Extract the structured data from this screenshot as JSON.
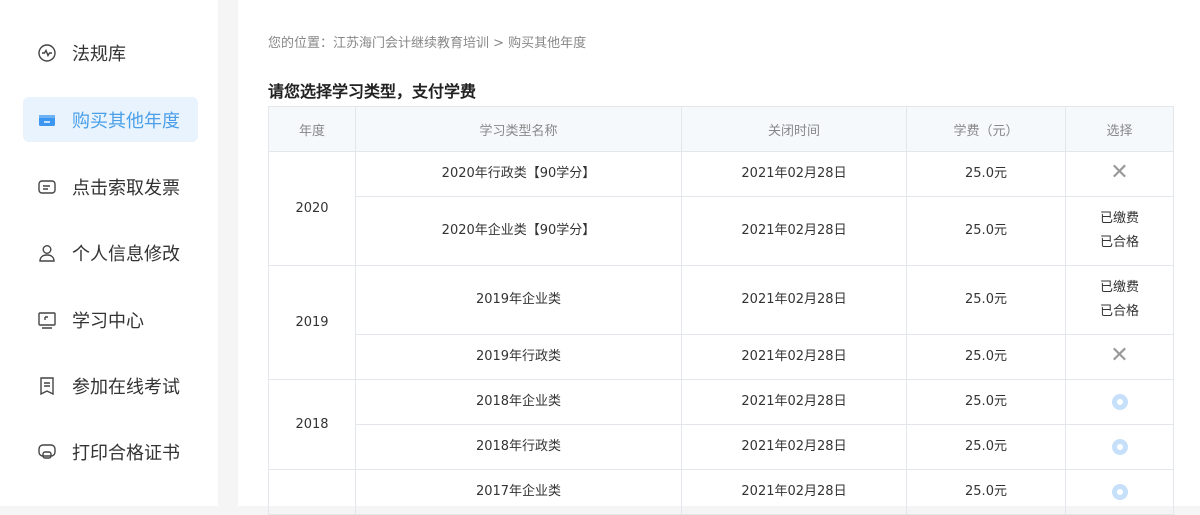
{
  "sidebar": {
    "items": [
      {
        "label": "法规库",
        "icon": "pulse-icon"
      },
      {
        "label": "购买其他年度",
        "icon": "wallet-icon",
        "active": true
      },
      {
        "label": "点击索取发票",
        "icon": "invoice-icon"
      },
      {
        "label": "个人信息修改",
        "icon": "user-icon"
      },
      {
        "label": "学习中心",
        "icon": "monitor-icon"
      },
      {
        "label": "参加在线考试",
        "icon": "bookmark-icon"
      },
      {
        "label": "打印合格证书",
        "icon": "printer-icon"
      }
    ]
  },
  "breadcrumb": {
    "prefix": "您的位置：",
    "path": "江苏海门会计继续教育培训 > 购买其他年度"
  },
  "title": "请您选择学习类型，支付学费",
  "table": {
    "headers": [
      "年度",
      "学习类型名称",
      "关闭时间",
      "学费（元）",
      "选择"
    ],
    "groups": [
      {
        "year": "2020",
        "rows": [
          {
            "name": "2020年行政类【90学分】",
            "close": "2021年02月28日",
            "fee": "25.0元",
            "select": "x"
          },
          {
            "name": "2020年企业类【90学分】",
            "close": "2021年02月28日",
            "fee": "25.0元",
            "select": "status",
            "status1": "已缴费",
            "status2": "已合格"
          }
        ]
      },
      {
        "year": "2019",
        "rows": [
          {
            "name": "2019年企业类",
            "close": "2021年02月28日",
            "fee": "25.0元",
            "select": "status",
            "status1": "已缴费",
            "status2": "已合格"
          },
          {
            "name": "2019年行政类",
            "close": "2021年02月28日",
            "fee": "25.0元",
            "select": "x"
          }
        ]
      },
      {
        "year": "2018",
        "rows": [
          {
            "name": "2018年企业类",
            "close": "2021年02月28日",
            "fee": "25.0元",
            "select": "radio"
          },
          {
            "name": "2018年行政类",
            "close": "2021年02月28日",
            "fee": "25.0元",
            "select": "radio"
          }
        ]
      },
      {
        "year": "",
        "rows": [
          {
            "name": "2017年企业类",
            "close": "2021年02月28日",
            "fee": "25.0元",
            "select": "radio"
          }
        ]
      }
    ]
  }
}
